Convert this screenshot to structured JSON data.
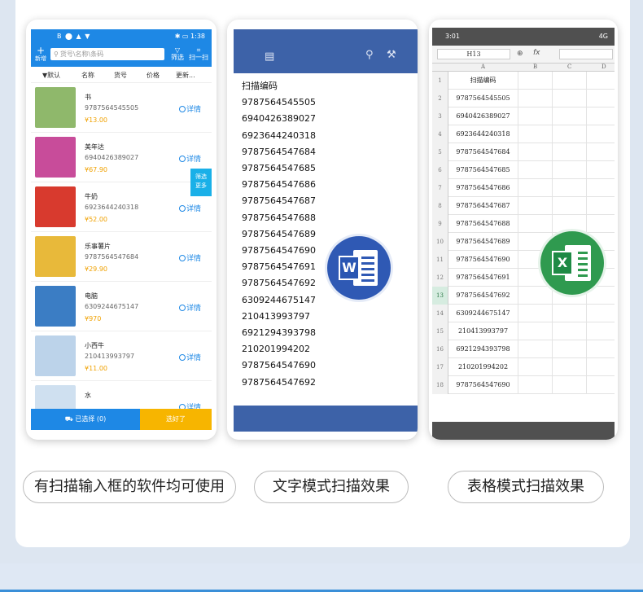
{
  "phone1": {
    "status_left": "B ⬤ ▲ ▼",
    "status_right": "✱ ▭ 1:38",
    "add_label": "新增",
    "search_placeholder": "货号\\名称\\条码",
    "filter_label": "筛选",
    "scan_label": "扫一扫",
    "tabs": [
      "▼默认",
      "名称",
      "货号",
      "价格",
      "更新..."
    ],
    "products": [
      {
        "name": "书",
        "code": "9787564545505",
        "price": "¥13.00",
        "detail": "详情",
        "img_color": "#8fb86b"
      },
      {
        "name": "美年达",
        "code": "6940426389027",
        "price": "¥67.90",
        "detail": "详情",
        "img_color": "#c84c9a"
      },
      {
        "name": "牛奶",
        "code": "6923644240318",
        "price": "¥52.00",
        "detail": "详情",
        "img_color": "#d83a2e"
      },
      {
        "name": "乐事薯片",
        "code": "9787564547684",
        "price": "¥29.90",
        "detail": "详情",
        "img_color": "#e8b93a"
      },
      {
        "name": "电脑",
        "code": "6309244675147",
        "price": "¥970",
        "detail": "详情",
        "img_color": "#3b7dc4"
      },
      {
        "name": "小西牛",
        "code": "210413993797",
        "price": "¥11.00",
        "detail": "详情",
        "img_color": "#bcd3ea"
      },
      {
        "name": "水",
        "code": "",
        "price": "",
        "detail": "详情",
        "img_color": "#cfe0f0"
      }
    ],
    "filter_tab": [
      "筛选",
      "更多"
    ],
    "selected_label": "已选择 (0)",
    "ok_label": "选好了"
  },
  "phone2": {
    "lines": [
      "扫描编码",
      "9787564545505",
      "6940426389027",
      "6923644240318",
      "9787564547684",
      "9787564547685",
      "9787564547686",
      "9787564547687",
      "9787564547688",
      "9787564547689",
      "9787564547690",
      "9787564547691",
      "9787564547692",
      "6309244675147",
      "210413993797",
      "6921294393798",
      "210201994202",
      "9787564547690",
      "9787564547692"
    ],
    "logo_letter": "W"
  },
  "phone3": {
    "time": "3:01",
    "status_right": "4G",
    "cell_ref": "H13",
    "fx": "fx",
    "columns": [
      "A",
      "B",
      "C",
      "D"
    ],
    "rows": [
      {
        "n": "1",
        "a": "扫描编码"
      },
      {
        "n": "2",
        "a": "9787564545505"
      },
      {
        "n": "3",
        "a": "6940426389027"
      },
      {
        "n": "4",
        "a": "6923644240318"
      },
      {
        "n": "5",
        "a": "9787564547684"
      },
      {
        "n": "6",
        "a": "9787564547685"
      },
      {
        "n": "7",
        "a": "9787564547686"
      },
      {
        "n": "8",
        "a": "9787564547687"
      },
      {
        "n": "9",
        "a": "9787564547688"
      },
      {
        "n": "10",
        "a": "9787564547689"
      },
      {
        "n": "11",
        "a": "9787564547690"
      },
      {
        "n": "12",
        "a": "9787564547691"
      },
      {
        "n": "13",
        "a": "9787564547692"
      },
      {
        "n": "14",
        "a": "6309244675147"
      },
      {
        "n": "15",
        "a": "210413993797"
      },
      {
        "n": "16",
        "a": "6921294393798"
      },
      {
        "n": "17",
        "a": "210201994202"
      },
      {
        "n": "18",
        "a": "9787564547690"
      }
    ],
    "logo_letter": "X"
  },
  "captions": [
    "有扫描输入框的软件均可使用",
    "文字模式扫描效果",
    "表格模式扫描效果"
  ],
  "colors": {
    "accent": "#1e88e5",
    "word": "#3d62a8",
    "excel": "#2f9a4f",
    "price": "#f0a100"
  }
}
